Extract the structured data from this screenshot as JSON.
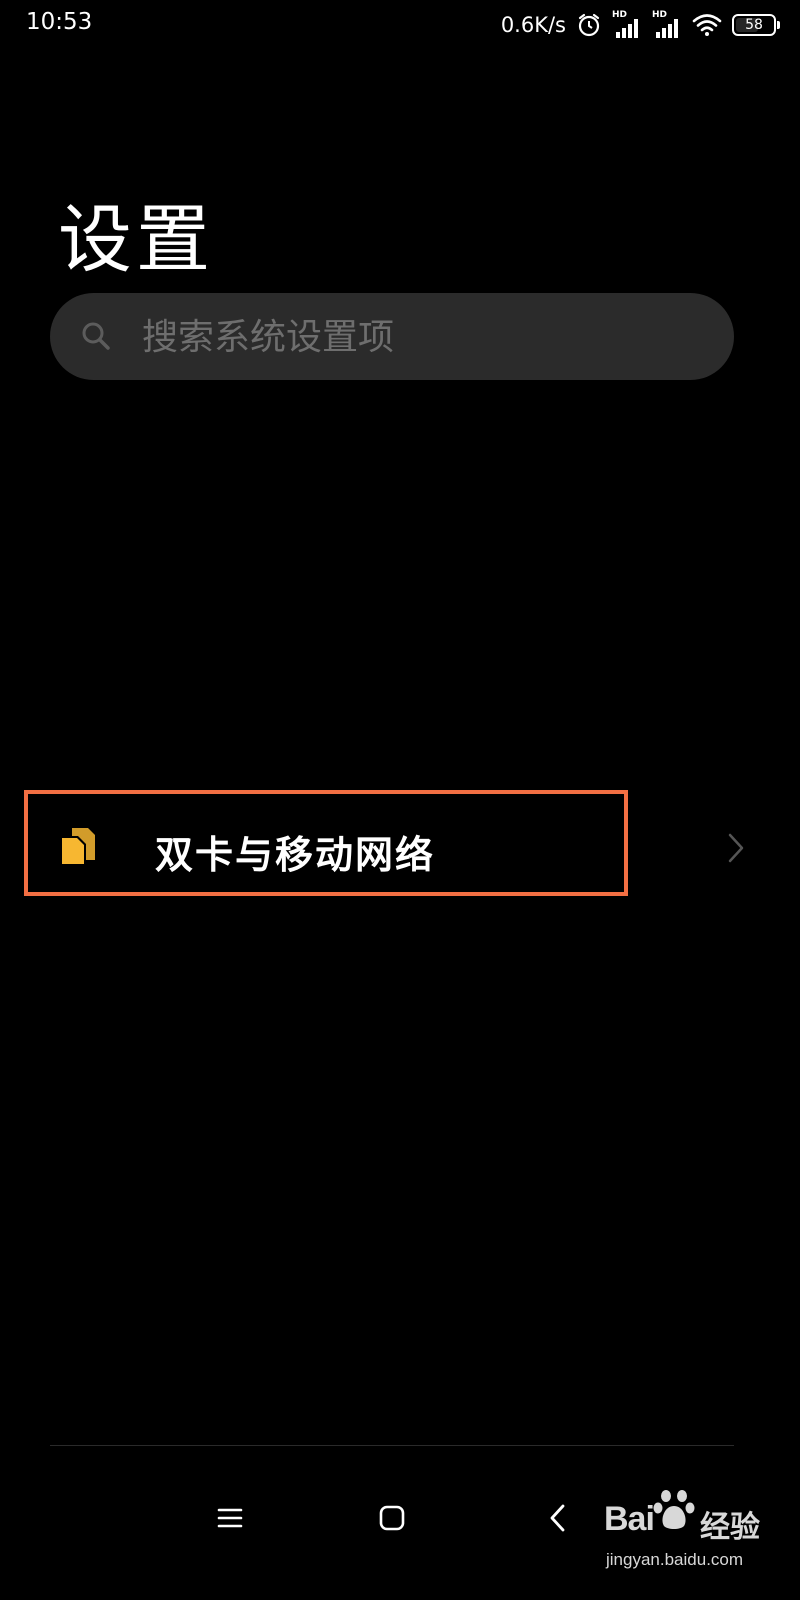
{
  "status_bar": {
    "time": "10:53",
    "net_speed": "0.6K/s",
    "sim1_label": "HD",
    "sim2_label": "HD",
    "battery": "58",
    "icons": [
      "alarm-icon",
      "signal-icon",
      "signal-icon",
      "wifi-icon",
      "battery-icon"
    ]
  },
  "page": {
    "title": "设置"
  },
  "search": {
    "placeholder": "搜索系统设置项",
    "icon": "search-icon"
  },
  "settings": {
    "items": [
      {
        "label": "双卡与移动网络",
        "icon": "sim-card-icon",
        "icon_color": "#f7b731"
      }
    ]
  },
  "highlight_color": "#f26f43",
  "nav": {
    "icons": [
      "menu-icon",
      "home-icon",
      "back-icon"
    ]
  },
  "watermark": {
    "logo": "Bai",
    "suffix": "经验",
    "url": "jingyan.baidu.com"
  }
}
